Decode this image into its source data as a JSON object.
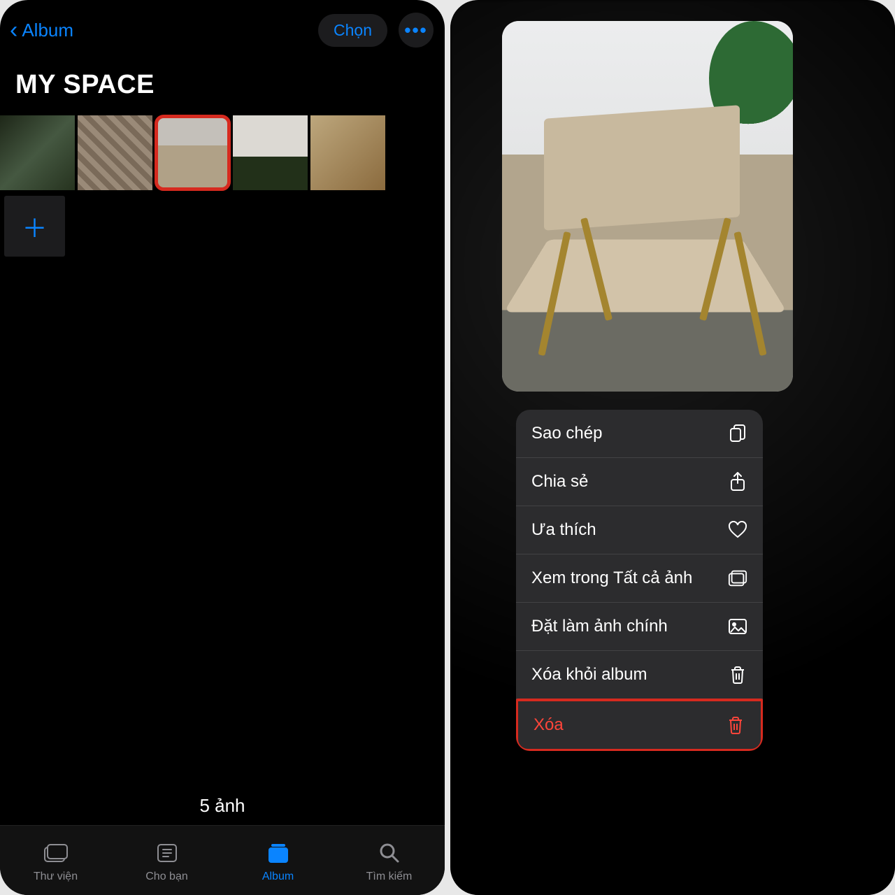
{
  "colors": {
    "accent": "#0a84ff",
    "danger": "#ff453a",
    "highlight_border": "#d62a1f"
  },
  "left": {
    "back_label": "Album",
    "choose_label": "Chọn",
    "title": "MY SPACE",
    "photo_count_label": "5 ảnh",
    "selected_thumb_index": 2,
    "tabs": [
      {
        "label": "Thư viện",
        "icon": "library-icon",
        "active": false
      },
      {
        "label": "Cho bạn",
        "icon": "for-you-icon",
        "active": false
      },
      {
        "label": "Album",
        "icon": "album-icon",
        "active": true
      },
      {
        "label": "Tìm kiếm",
        "icon": "search-icon",
        "active": false
      }
    ]
  },
  "right": {
    "menu": [
      {
        "label": "Sao chép",
        "icon": "copy-icon",
        "danger": false
      },
      {
        "label": "Chia sẻ",
        "icon": "share-icon",
        "danger": false
      },
      {
        "label": "Ưa thích",
        "icon": "heart-icon",
        "danger": false
      },
      {
        "label": "Xem trong Tất cả ảnh",
        "icon": "gallery-icon",
        "danger": false
      },
      {
        "label": "Đặt làm ảnh chính",
        "icon": "picture-icon",
        "danger": false
      },
      {
        "label": "Xóa khỏi album",
        "icon": "trash-icon",
        "danger": false
      },
      {
        "label": "Xóa",
        "icon": "trash-icon",
        "danger": true
      }
    ]
  }
}
